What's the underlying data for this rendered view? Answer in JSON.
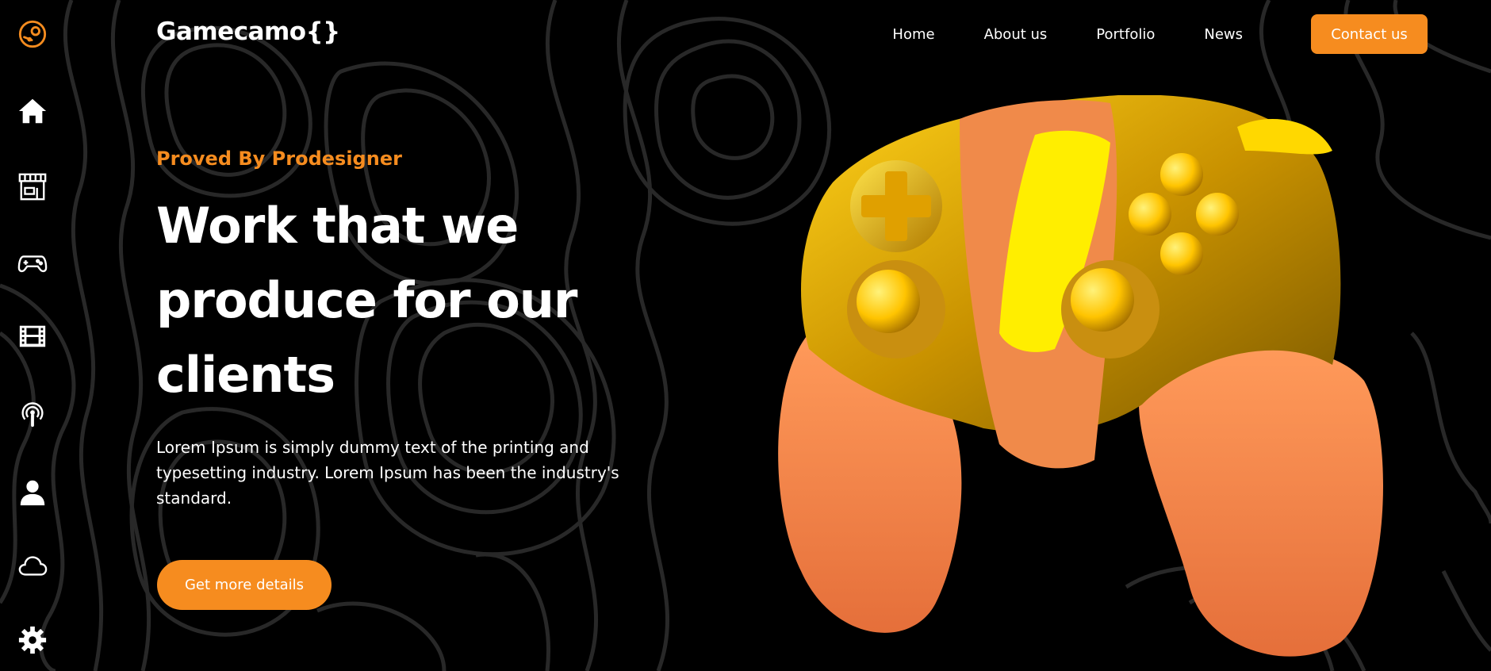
{
  "sidebar": {
    "items": [
      {
        "icon": "steam-icon"
      },
      {
        "icon": "home-icon"
      },
      {
        "icon": "store-icon"
      },
      {
        "icon": "gamepad-icon"
      },
      {
        "icon": "film-icon"
      },
      {
        "icon": "podcast-icon"
      },
      {
        "icon": "user-icon"
      },
      {
        "icon": "cloud-icon"
      },
      {
        "icon": "settings-icon"
      }
    ]
  },
  "header": {
    "logo": "Gamecamo{}",
    "nav": [
      "Home",
      "About us",
      "Portfolio",
      "News"
    ],
    "contact_label": "Contact us"
  },
  "hero": {
    "eyebrow": "Proved By Prodesigner",
    "headline_lines": [
      "Work that we",
      "produce for our",
      "clients"
    ],
    "body": "Lorem Ipsum is simply dummy text of the printing and typesetting industry. Lorem Ipsum has been the industry's standard.",
    "cta_label": "Get more details",
    "image": "game-controller-3d"
  },
  "colors": {
    "accent": "#f68c1f",
    "background": "#000000",
    "text": "#ffffff",
    "contour_lines": "#2a2a2a"
  }
}
